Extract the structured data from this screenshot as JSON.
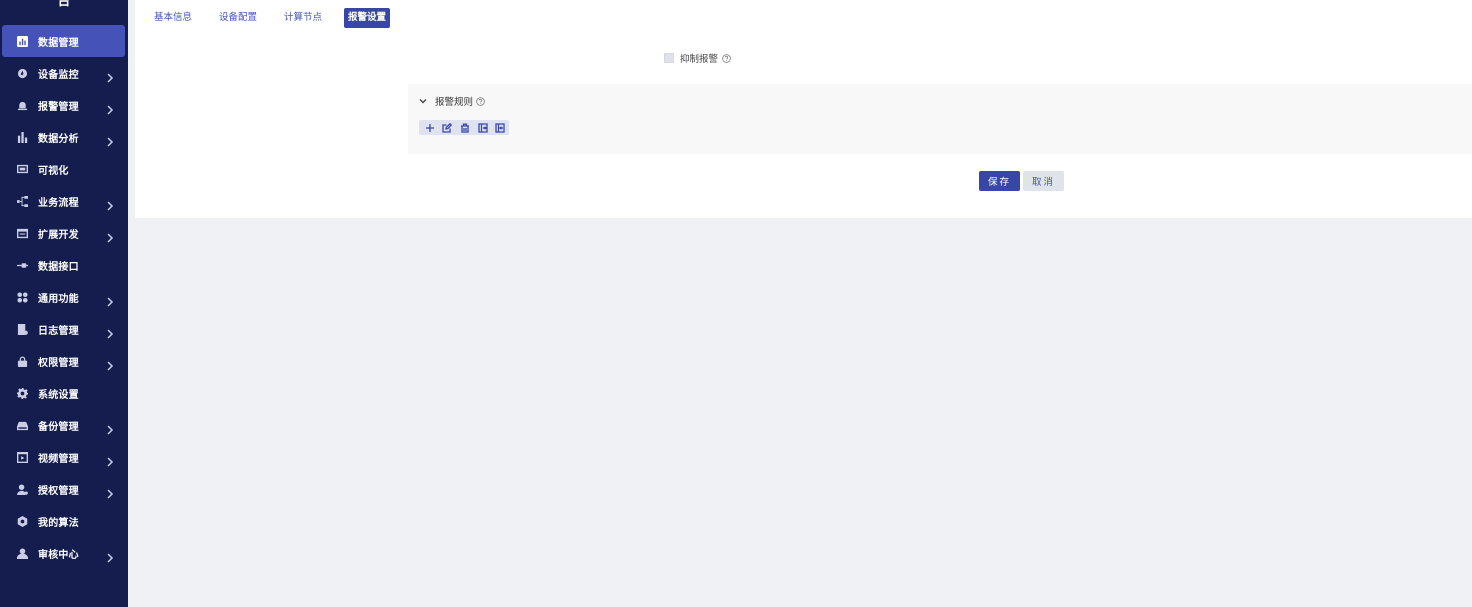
{
  "sidebar": {
    "brand_partial": "台",
    "items": [
      {
        "label": "数据管理",
        "icon": "bar-chart-icon",
        "active": true,
        "has_arrow": false
      },
      {
        "label": "设备监控",
        "icon": "monitor-gauge-icon",
        "active": false,
        "has_arrow": true
      },
      {
        "label": "报警管理",
        "icon": "alarm-bell-icon",
        "active": false,
        "has_arrow": true
      },
      {
        "label": "数据分析",
        "icon": "analytics-bars-icon",
        "active": false,
        "has_arrow": true
      },
      {
        "label": "可视化",
        "icon": "screen-icon",
        "active": false,
        "has_arrow": false
      },
      {
        "label": "业务流程",
        "icon": "flow-icon",
        "active": false,
        "has_arrow": true
      },
      {
        "label": "扩展开发",
        "icon": "code-window-icon",
        "active": false,
        "has_arrow": true
      },
      {
        "label": "数据接口",
        "icon": "connector-icon",
        "active": false,
        "has_arrow": false
      },
      {
        "label": "通用功能",
        "icon": "grid-apps-icon",
        "active": false,
        "has_arrow": true
      },
      {
        "label": "日志管理",
        "icon": "log-file-icon",
        "active": false,
        "has_arrow": true
      },
      {
        "label": "权限管理",
        "icon": "lock-icon",
        "active": false,
        "has_arrow": true
      },
      {
        "label": "系统设置",
        "icon": "gear-icon",
        "active": false,
        "has_arrow": false
      },
      {
        "label": "备份管理",
        "icon": "storage-icon",
        "active": false,
        "has_arrow": true
      },
      {
        "label": "视频管理",
        "icon": "video-icon",
        "active": false,
        "has_arrow": true
      },
      {
        "label": "授权管理",
        "icon": "user-key-icon",
        "active": false,
        "has_arrow": true
      },
      {
        "label": "我的算法",
        "icon": "algorithm-icon",
        "active": false,
        "has_arrow": false
      },
      {
        "label": "审核中心",
        "icon": "reviewer-icon",
        "active": false,
        "has_arrow": true
      }
    ]
  },
  "tabs": [
    {
      "label": "基本信息",
      "active": false
    },
    {
      "label": "设备配置",
      "active": false
    },
    {
      "label": "计算节点",
      "active": false
    },
    {
      "label": "报警设置",
      "active": true
    }
  ],
  "form": {
    "suppress_label": "抑制报警",
    "suppress_checked": false,
    "rules_title": "报警规则",
    "toolbar_icons": [
      "add-icon",
      "edit-icon",
      "delete-icon",
      "import-icon",
      "export-icon"
    ]
  },
  "actions": {
    "save_label": "保存",
    "cancel_label": "取消"
  },
  "colors": {
    "sidebar_bg": "#141d4d",
    "accent": "#3846a8",
    "active_menu": "#4553b8",
    "page_bg": "#f0f1f5"
  }
}
